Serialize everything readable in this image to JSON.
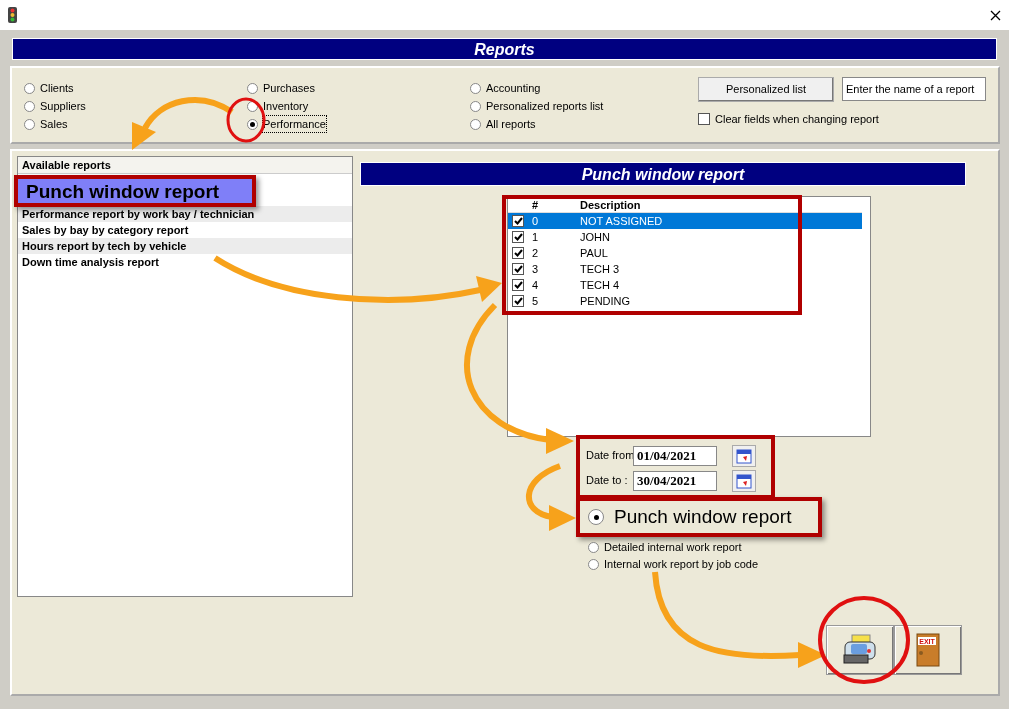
{
  "banner": {
    "title": "Reports"
  },
  "report_groups": [
    {
      "label": "Clients",
      "selected": false
    },
    {
      "label": "Suppliers",
      "selected": false
    },
    {
      "label": "Sales",
      "selected": false
    },
    {
      "label": "Purchases",
      "selected": false
    },
    {
      "label": "Inventory",
      "selected": false
    },
    {
      "label": "Performance",
      "selected": true
    },
    {
      "label": "Accounting",
      "selected": false
    },
    {
      "label": "Personalized reports list",
      "selected": false
    },
    {
      "label": "All reports",
      "selected": false
    }
  ],
  "personalized_button": {
    "label": "Personalized list"
  },
  "report_name_field": {
    "value": "Enter the name of a report"
  },
  "clear_fields": {
    "label": "Clear fields when changing report",
    "checked": false
  },
  "available_reports": {
    "header": "Available reports",
    "items": [
      {
        "label": "Punch window report",
        "selected": true,
        "callout": true
      },
      {
        "label": "Performance report by work bay / technician",
        "selected": false,
        "callout": false
      },
      {
        "label": "Sales by bay by category report",
        "selected": false,
        "callout": false
      },
      {
        "label": "Hours report by tech by vehicle",
        "selected": false,
        "callout": false
      },
      {
        "label": "Down time analysis report",
        "selected": false,
        "callout": false
      }
    ]
  },
  "report_panel": {
    "title": "Punch window report",
    "technicians": {
      "columns": [
        "#",
        "Description"
      ],
      "rows": [
        {
          "number": "0",
          "description": "NOT ASSIGNED",
          "checked": true,
          "selected": true
        },
        {
          "number": "1",
          "description": "JOHN",
          "checked": true,
          "selected": false
        },
        {
          "number": "2",
          "description": "PAUL",
          "checked": true,
          "selected": false
        },
        {
          "number": "3",
          "description": "TECH 3",
          "checked": true,
          "selected": false
        },
        {
          "number": "4",
          "description": "TECH 4",
          "checked": true,
          "selected": false
        },
        {
          "number": "5",
          "description": "PENDING",
          "checked": true,
          "selected": false
        }
      ]
    },
    "date_from": {
      "label": "Date from",
      "value": "01/04/2021"
    },
    "date_to": {
      "label": "Date to :",
      "value": "30/04/2021"
    },
    "report_types": [
      {
        "label": "Punch window report",
        "selected": true,
        "callout": true
      },
      {
        "label": "Detailed internal work report",
        "selected": false,
        "callout": false
      },
      {
        "label": "Internal work report by job code",
        "selected": false,
        "callout": false
      }
    ]
  },
  "exit_button": {
    "icon_text": "EXIT"
  }
}
